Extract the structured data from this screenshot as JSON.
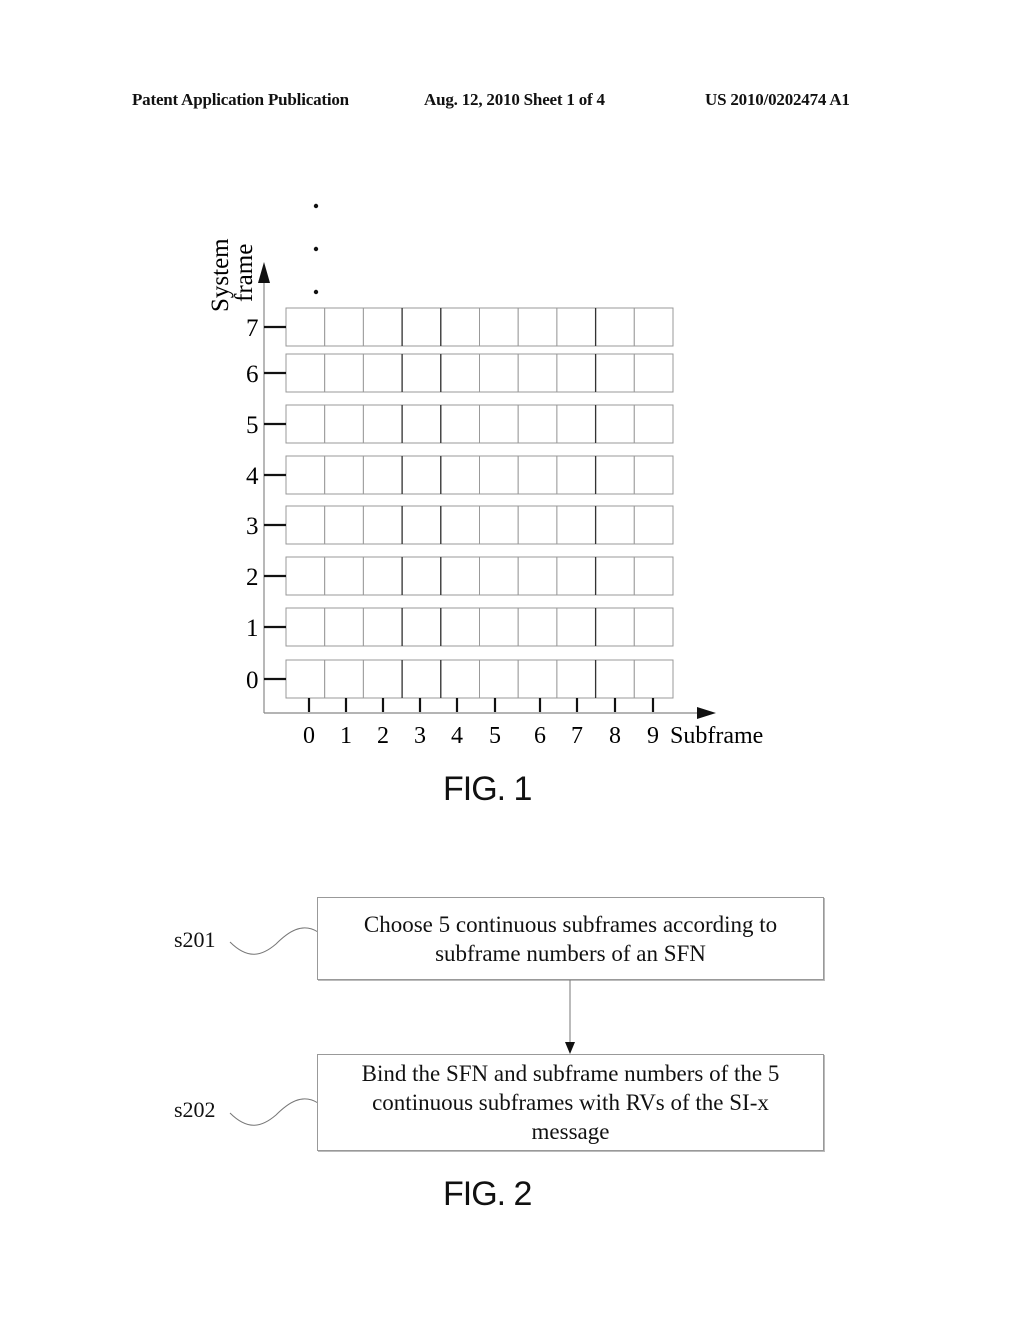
{
  "header": {
    "left": "Patent Application Publication",
    "date_sheet": "Aug. 12, 2010  Sheet 1 of 4",
    "number": "US 2010/0202474 A1"
  },
  "fig1": {
    "caption": "FIG. 1",
    "y_axis_label_line1": "System",
    "y_axis_label_line2": "frame",
    "x_axis_label": "Subframe",
    "system_frames": [
      "0",
      "1",
      "2",
      "3",
      "4",
      "5",
      "6",
      "7"
    ],
    "subframes": [
      "0",
      "1",
      "2",
      "3",
      "4",
      "5",
      "6",
      "7",
      "8",
      "9"
    ],
    "continuation": "• • •"
  },
  "fig2": {
    "caption": "FIG. 2",
    "steps": [
      {
        "id": "s201",
        "text": "Choose 5 continuous subframes according to subframe numbers of an SFN"
      },
      {
        "id": "s202",
        "text": "Bind the SFN and subframe numbers of the 5 continuous subframes with RVs of the SI-x message"
      }
    ]
  }
}
